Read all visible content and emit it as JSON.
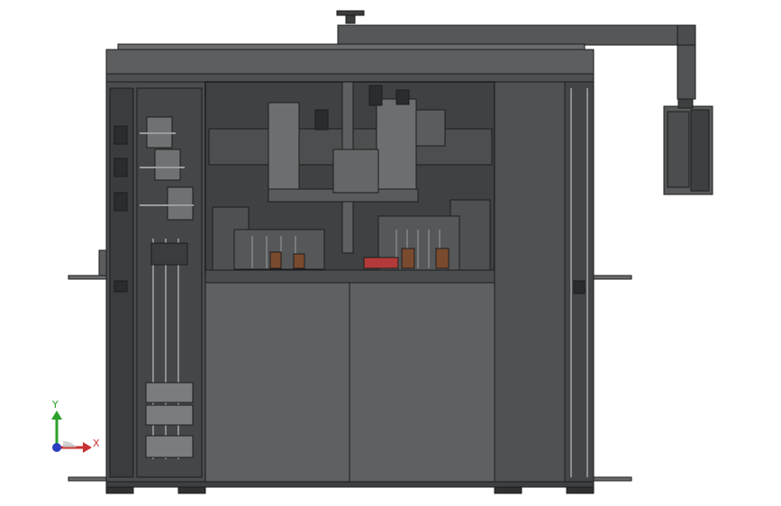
{
  "viewport": {
    "background": "#ffffff",
    "model": "machine-front-view"
  },
  "colors": {
    "frame": "#4a4c4d",
    "frame_dark": "#2e3031",
    "panel": "#5e6061",
    "panel_light": "#6c6e6f",
    "window_bg": "#3f4142",
    "detail": "#8c8f91",
    "accent_red": "#b23a3a",
    "accent_brown": "#7a4a2e",
    "outline": "#1c1d1e"
  },
  "triad": {
    "y_label": "Y",
    "x_label": "X",
    "y_color": "#2aa02a",
    "x_color": "#c83232",
    "z_color": "#2a3fbf"
  }
}
